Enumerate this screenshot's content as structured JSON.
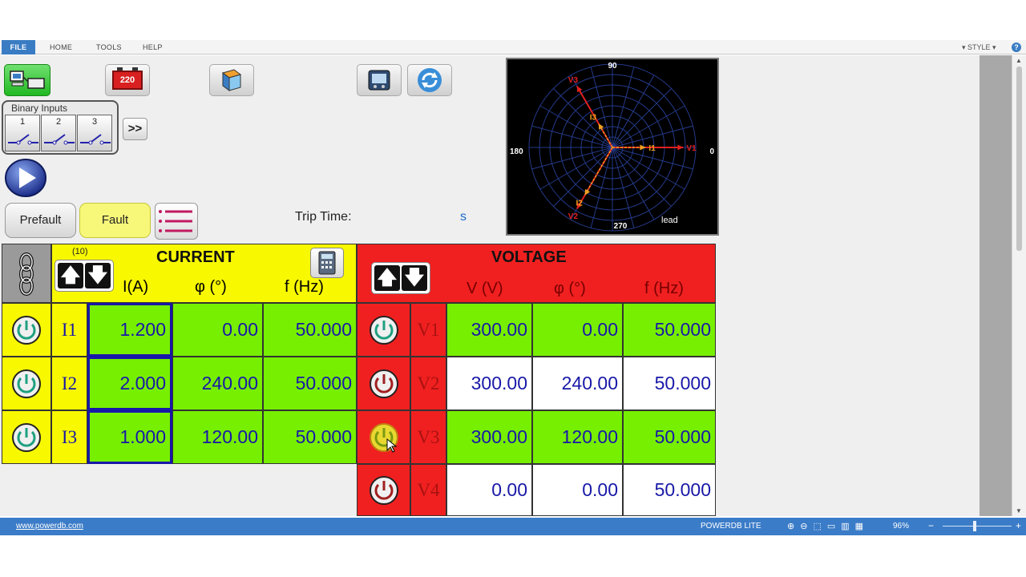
{
  "menu": {
    "file": "FILE",
    "home": "HOME",
    "tools": "TOOLS",
    "help": "HELP",
    "style": "STYLE",
    "help_icon": "?"
  },
  "toolbar": {
    "battery_label": "220"
  },
  "binary_inputs": {
    "title": "Binary Inputs",
    "channels": [
      "1",
      "2",
      "3"
    ],
    "more_label": ">>"
  },
  "modes": {
    "prefault": "Prefault",
    "fault": "Fault"
  },
  "trip": {
    "label": "Trip Time:",
    "unit": "s"
  },
  "phasor": {
    "labels": {
      "top": "90",
      "left": "180",
      "right": "0",
      "bottom": "270",
      "mode": "lead"
    },
    "vectors": [
      {
        "name": "V1",
        "angle": 0,
        "magnitude": 300,
        "color": "#e02020"
      },
      {
        "name": "V2",
        "angle": 240,
        "magnitude": 300,
        "color": "#e02020"
      },
      {
        "name": "V3",
        "angle": 120,
        "magnitude": 300,
        "color": "#e02020"
      },
      {
        "name": "I1",
        "angle": 0,
        "magnitude": 1.2,
        "color": "#f0a020"
      },
      {
        "name": "I2",
        "angle": 240,
        "magnitude": 2.0,
        "color": "#f0a020"
      },
      {
        "name": "I3",
        "angle": 120,
        "magnitude": 1.0,
        "color": "#f0a020"
      }
    ]
  },
  "current": {
    "title": "CURRENT",
    "count": "(10)",
    "headers": {
      "mag": "I(A)",
      "phase": "φ  (°)",
      "freq": "f  (Hz)"
    },
    "rows": [
      {
        "label": "I1",
        "mag": "1.200",
        "phase": "0.00",
        "freq": "50.000"
      },
      {
        "label": "I2",
        "mag": "2.000",
        "phase": "240.00",
        "freq": "50.000"
      },
      {
        "label": "I3",
        "mag": "1.000",
        "phase": "120.00",
        "freq": "50.000"
      }
    ]
  },
  "voltage": {
    "title": "VOLTAGE",
    "headers": {
      "mag": "V  (V)",
      "phase": "φ  (°)",
      "freq": "f  (Hz)"
    },
    "rows": [
      {
        "label": "V1",
        "mag": "300.00",
        "phase": "0.00",
        "freq": "50.000"
      },
      {
        "label": "V2",
        "mag": "300.00",
        "phase": "240.00",
        "freq": "50.000"
      },
      {
        "label": "V3",
        "mag": "300.00",
        "phase": "120.00",
        "freq": "50.000"
      },
      {
        "label": "V4",
        "mag": "0.00",
        "phase": "0.00",
        "freq": "50.000"
      }
    ]
  },
  "arrows": {
    "up": "🡅",
    "down": "🡇"
  },
  "status": {
    "link": "www.powerdb.com",
    "app": "POWERDB LITE",
    "zoom": "96%",
    "minus": "−",
    "plus": "+"
  }
}
